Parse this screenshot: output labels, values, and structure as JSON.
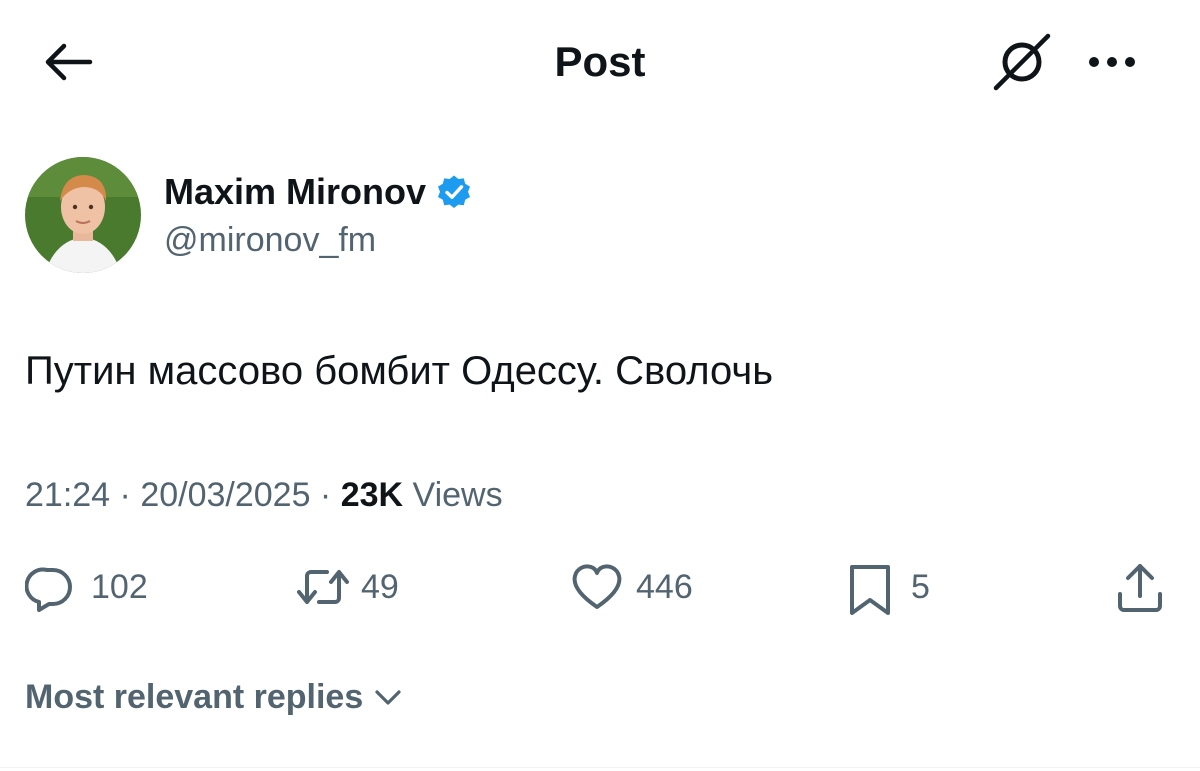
{
  "header": {
    "title": "Post",
    "back_icon": "arrow-left-icon",
    "grok_icon": "grok-icon",
    "more_icon": "more-horizontal-icon"
  },
  "author": {
    "name": "Maxim Mironov",
    "handle": "@mironov_fm",
    "verified": true,
    "verified_color": "#1d9bf0"
  },
  "tweet": {
    "text": "Путин массово бомбит Одессу. Сволочь",
    "time": "21:24",
    "date": "20/03/2025",
    "separator": " · ",
    "views_count": "23K",
    "views_label": "Views"
  },
  "actions": {
    "replies": "102",
    "reposts": "49",
    "likes": "446",
    "bookmarks": "5"
  },
  "replies_sort": {
    "label": "Most relevant replies"
  },
  "colors": {
    "text_primary": "#0f1419",
    "text_secondary": "#536471",
    "accent": "#1d9bf0",
    "background": "#ffffff"
  }
}
